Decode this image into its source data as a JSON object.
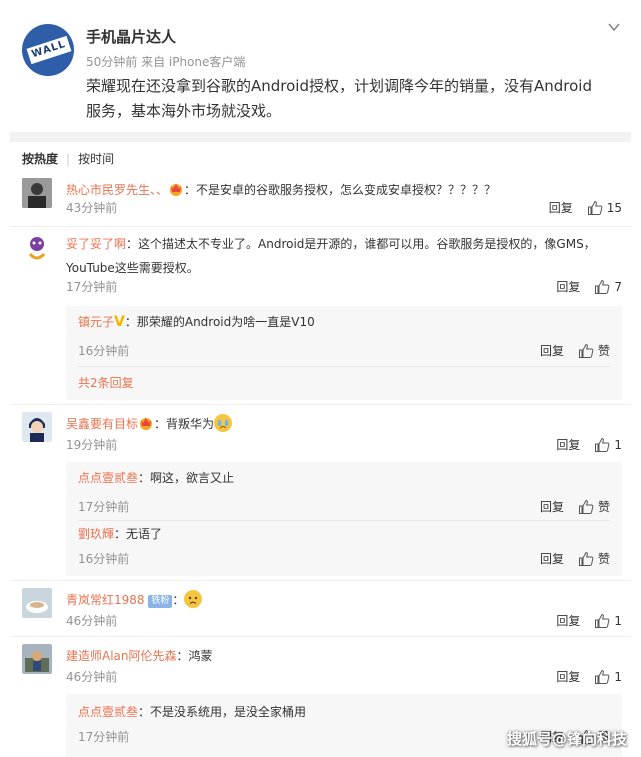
{
  "post": {
    "author": "手机晶片达人",
    "meta": "50分钟前 来自 iPhone客户端",
    "text": "荣耀现在还没拿到谷歌的Android授权，计划调降今年的销量，没有Android 服务，基本海外市场就没戏。",
    "avatar_text": "WALL"
  },
  "sort": {
    "hot": "按热度",
    "time": "按时间"
  },
  "comments": [
    {
      "name": "热心市民罗先生、、",
      "text": "：不是安卓的谷歌服务授权，怎么变成安卓授权？？？？？",
      "time": "43分钟前",
      "reply": "回复",
      "likes": "15"
    },
    {
      "name": "妥了妥了啊",
      "text": "：这个描述太不专业了。Android是开源的，谁都可以用。谷歌服务是授权的，像GMS，YouTube这些需要授权。",
      "time": "17分钟前",
      "reply": "回复",
      "likes": "7",
      "replies": [
        {
          "name": "镇元子",
          "text": "：那荣耀的Android为啥一直是V10",
          "time": "16分钟前",
          "reply": "回复",
          "likes": "赞"
        }
      ],
      "more": "共2条回复"
    },
    {
      "name": "吴鑫要有目标",
      "text": "：背叛华为",
      "time": "19分钟前",
      "reply": "回复",
      "likes": "1",
      "replies": [
        {
          "name": "点点壹贰叁",
          "text": "：啊这，欲言又止",
          "time": "17分钟前",
          "reply": "回复",
          "likes": "赞"
        },
        {
          "name": "劉玖輝",
          "text": "：无语了",
          "time": "16分钟前",
          "reply": "回复",
          "likes": "赞"
        }
      ]
    },
    {
      "name": "青岚常红1988",
      "fan_badge": "铁粉",
      "text": "：",
      "time": "46分钟前",
      "reply": "回复",
      "likes": "1"
    },
    {
      "name": "建造师Alan阿伦先森",
      "text": "：鸿蒙",
      "time": "46分钟前",
      "reply": "回复",
      "likes": "1",
      "replies": [
        {
          "name": "点点壹贰叁",
          "text": "：不是没系统用，是没全家桶用",
          "time": "17分钟前",
          "reply": "回复",
          "likes": "赞"
        }
      ]
    }
  ],
  "watermark": "搜狐号@锋向科技",
  "colors": {
    "name": "#eb7350",
    "time": "#939393",
    "reply_bg": "#f7f7f7"
  },
  "icons": [
    "chevron-down-icon",
    "thumb-up-icon",
    "crown-badge-icon",
    "v-badge-icon",
    "emoji-cry-icon",
    "emoji-sad-icon"
  ]
}
